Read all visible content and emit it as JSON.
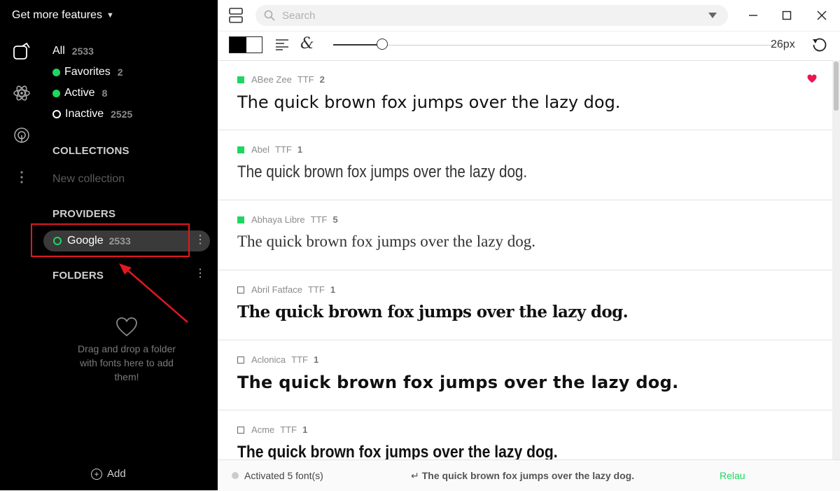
{
  "sidebar": {
    "get_more": "Get more features",
    "nav": [
      {
        "label": "All",
        "count": "2533"
      },
      {
        "label": "Favorites",
        "count": "2"
      },
      {
        "label": "Active",
        "count": "8"
      },
      {
        "label": "Inactive",
        "count": "2525"
      }
    ],
    "collections_head": "COLLECTIONS",
    "new_collection": "New collection",
    "providers_head": "PROVIDERS",
    "provider": {
      "label": "Google",
      "count": "2533"
    },
    "folders_head": "FOLDERS",
    "folders_empty": "Drag and drop a folder with fonts here to add them!",
    "add_label": "Add"
  },
  "topbar": {
    "search_placeholder": "Search"
  },
  "toolbar": {
    "size_label": "26px",
    "slider_fraction": 0.11
  },
  "fonts": [
    {
      "name": "ABee Zee",
      "format": "TTF",
      "styles": "2",
      "active": true,
      "favorite": true,
      "sample": "The quick brown fox jumps over the lazy dog."
    },
    {
      "name": "Abel",
      "format": "TTF",
      "styles": "1",
      "active": true,
      "favorite": false,
      "sample": "The quick brown fox jumps over the lazy dog."
    },
    {
      "name": "Abhaya Libre",
      "format": "TTF",
      "styles": "5",
      "active": true,
      "favorite": false,
      "sample": "The quick brown fox jumps over the lazy dog."
    },
    {
      "name": "Abril Fatface",
      "format": "TTF",
      "styles": "1",
      "active": false,
      "favorite": false,
      "sample": "The quick brown fox jumps over the lazy dog."
    },
    {
      "name": "Aclonica",
      "format": "TTF",
      "styles": "1",
      "active": false,
      "favorite": false,
      "sample": "The quick brown fox jumps over the lazy dog."
    },
    {
      "name": "Acme",
      "format": "TTF",
      "styles": "1",
      "active": false,
      "favorite": false,
      "sample": "The quick brown fox jumps over the lazy dog."
    }
  ],
  "statusbar": {
    "activated": "Activated 5 font(s)",
    "preview_symbol": "↵",
    "preview": "The quick brown fox jumps over the lazy dog.",
    "relaunch": "Relau"
  },
  "colors": {
    "accent": "#1ed760",
    "highlight": "#e0191f",
    "heart": "#e8174f"
  }
}
